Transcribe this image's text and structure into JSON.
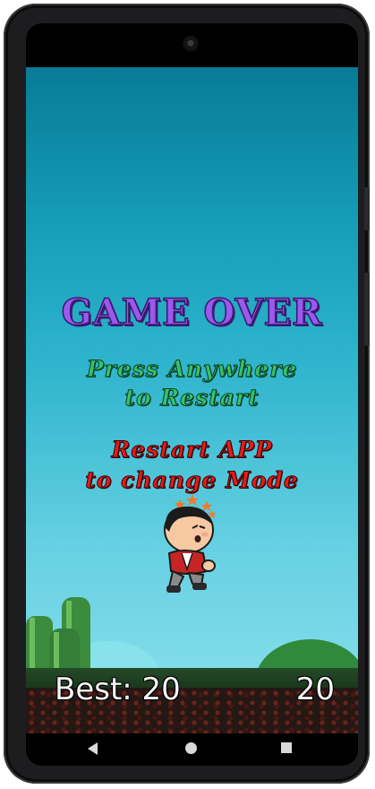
{
  "game": {
    "title": "GAME OVER",
    "prompt_line1": "Press Anywhere",
    "prompt_line2": "to Restart",
    "mode_line1": "Restart APP",
    "mode_line2": "to change Mode",
    "best_score": "Best: 20",
    "current_score": "20",
    "player_state": "dizzy"
  },
  "colors": {
    "title": "#9b59ee",
    "prompt": "#35c26c",
    "mode_text": "#e21c1c",
    "sky_top": "#087b97",
    "sky_bottom": "#8ee1ee"
  },
  "nav": {
    "back_icon": "back-triangle-icon",
    "home_icon": "home-circle-icon",
    "recents_icon": "recents-square-icon"
  }
}
